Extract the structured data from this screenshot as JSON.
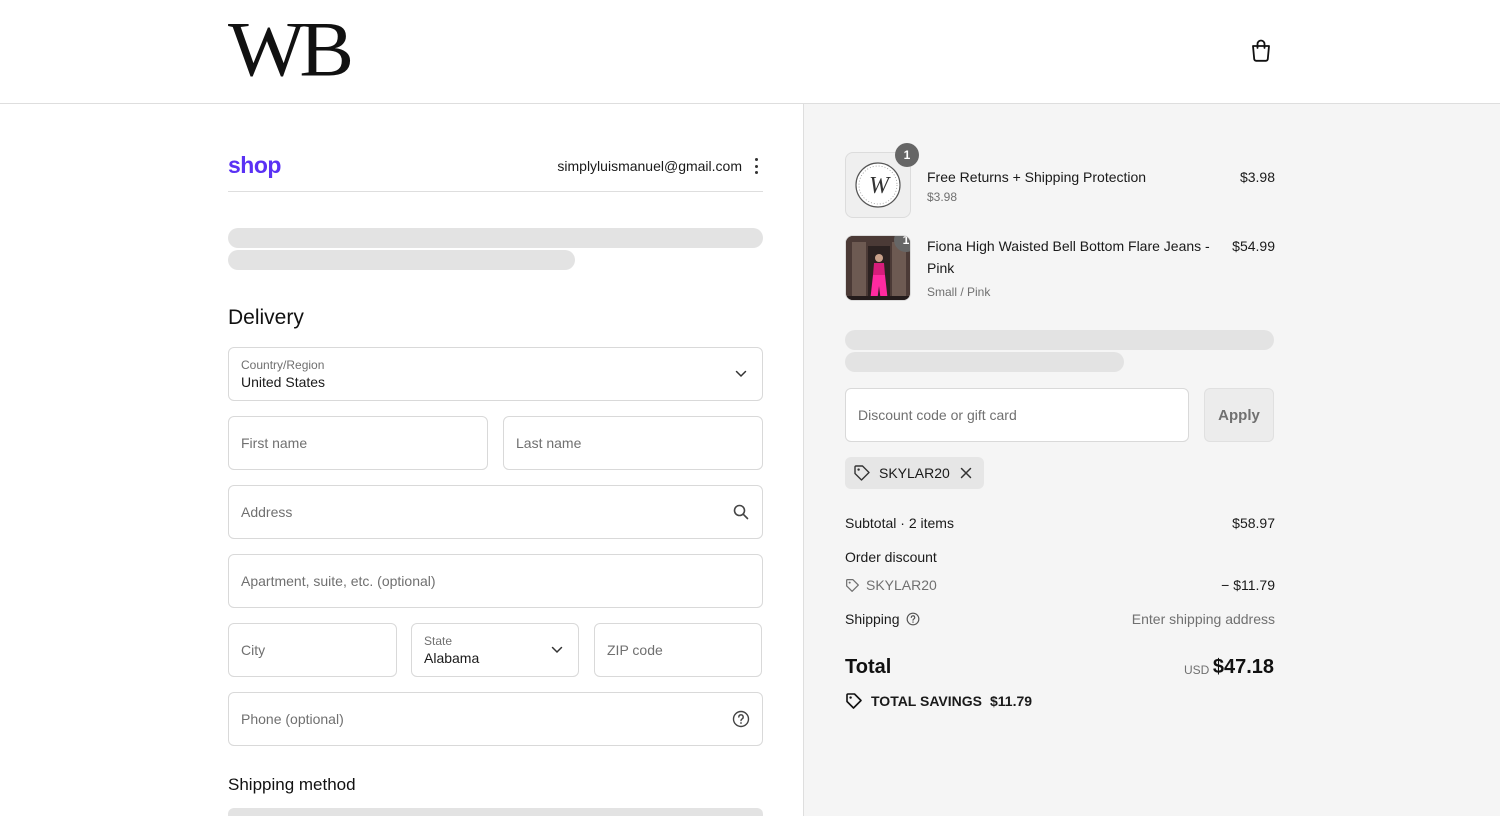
{
  "header": {
    "logo_text": "WB",
    "cart_icon": "shopping-bag-icon"
  },
  "account": {
    "brand": "shop",
    "email": "simplyluismanuel@gmail.com",
    "menu_icon": "kebab-menu-icon"
  },
  "delivery": {
    "title": "Delivery",
    "country": {
      "label": "Country/Region",
      "value": "United States"
    },
    "first_name": {
      "placeholder": "First name"
    },
    "last_name": {
      "placeholder": "Last name"
    },
    "address": {
      "placeholder": "Address"
    },
    "apartment": {
      "placeholder": "Apartment, suite, etc. (optional)"
    },
    "city": {
      "placeholder": "City"
    },
    "state": {
      "label": "State",
      "value": "Alabama"
    },
    "zip": {
      "placeholder": "ZIP code"
    },
    "phone": {
      "placeholder": "Phone (optional)"
    }
  },
  "shipping_method": {
    "title": "Shipping method"
  },
  "cart": {
    "items": [
      {
        "name": "Free Returns + Shipping Protection",
        "sub": "$3.98",
        "price": "$3.98",
        "qty": "1",
        "thumb_letter": "W"
      },
      {
        "name": "Fiona High Waisted Bell Bottom Flare Jeans - Pink",
        "sub": "Small / Pink",
        "price": "$54.99",
        "qty": "1"
      }
    ],
    "discount": {
      "placeholder": "Discount code or gift card",
      "apply_label": "Apply",
      "applied_code": "SKYLAR20"
    },
    "summary": {
      "subtotal_label": "Subtotal · 2 items",
      "subtotal_value": "$58.97",
      "order_discount_label": "Order discount",
      "order_discount_code": "SKYLAR20",
      "order_discount_value": "− $11.79",
      "shipping_label": "Shipping",
      "shipping_value": "Enter shipping address",
      "total_label": "Total",
      "currency": "USD",
      "total_value": "$47.18",
      "savings_label": "TOTAL SAVINGS",
      "savings_value": "$11.79"
    }
  },
  "colors": {
    "shop_brand": "#5a31f4",
    "right_panel_bg": "#f5f5f5",
    "skeleton": "#e3e3e3"
  }
}
